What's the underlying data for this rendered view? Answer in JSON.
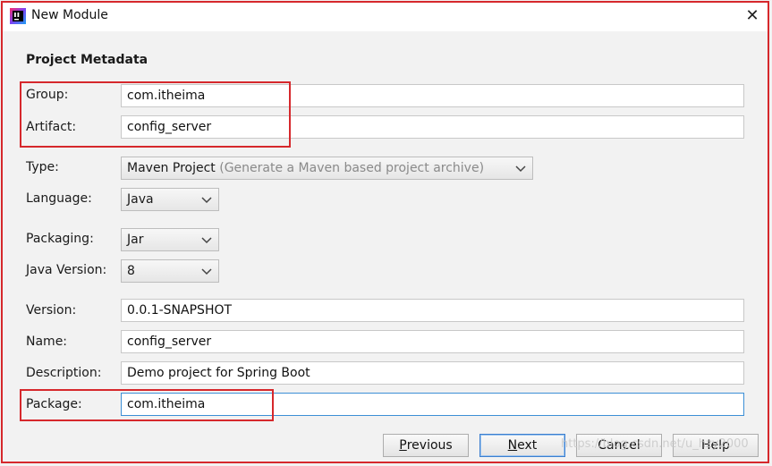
{
  "window": {
    "title": "New Module",
    "close_glyph": "✕"
  },
  "section_title": "Project Metadata",
  "fields": {
    "group": {
      "label": "Group:",
      "value": "com.itheima"
    },
    "artifact": {
      "label": "Artifact:",
      "value": "config_server"
    },
    "type": {
      "label": "Type:",
      "value": "Maven Project",
      "hint": "(Generate a Maven based project archive)"
    },
    "language": {
      "label": "Language:",
      "value": "Java"
    },
    "packaging": {
      "label": "Packaging:",
      "value": "Jar"
    },
    "java_version": {
      "label": "Java Version:",
      "value": "8"
    },
    "version": {
      "label": "Version:",
      "value": "0.0.1-SNAPSHOT"
    },
    "name": {
      "label": "Name:",
      "value": "config_server"
    },
    "description": {
      "label": "Description:",
      "value": "Demo project for Spring Boot"
    },
    "package": {
      "label": "Package:",
      "value": "com.itheima"
    }
  },
  "buttons": {
    "previous": {
      "mnemonic": "P",
      "rest": "revious"
    },
    "next": {
      "mnemonic": "N",
      "rest": "ext"
    },
    "cancel": {
      "label": "Cancel"
    },
    "help": {
      "label": "Help"
    }
  },
  "watermark": "https://blog.csdn.net/u_hzy2000",
  "colors": {
    "highlight": "#d6282c",
    "focus": "#3c8fd6",
    "hint": "#8a8a8a"
  },
  "icons": {
    "app": "intellij-idea-icon",
    "close": "close-icon",
    "dropdown": "chevron-down-icon"
  }
}
